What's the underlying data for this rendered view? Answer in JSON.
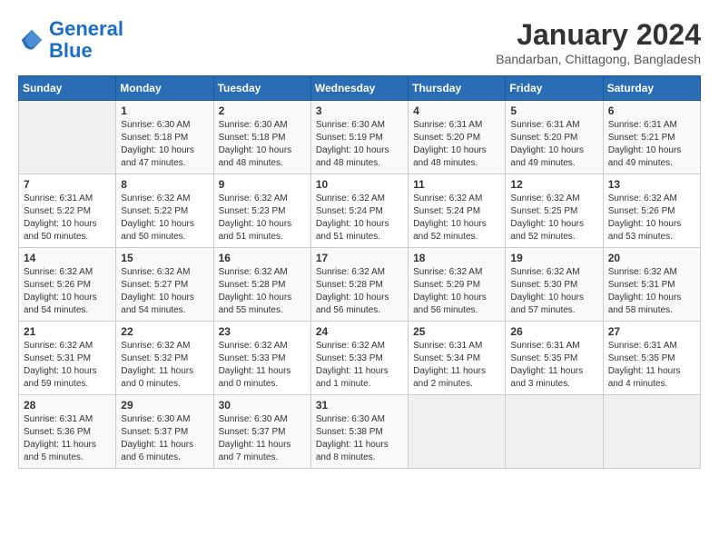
{
  "header": {
    "logo_line1": "General",
    "logo_line2": "Blue",
    "month_year": "January 2024",
    "location": "Bandarban, Chittagong, Bangladesh"
  },
  "weekdays": [
    "Sunday",
    "Monday",
    "Tuesday",
    "Wednesday",
    "Thursday",
    "Friday",
    "Saturday"
  ],
  "weeks": [
    [
      {
        "day": "",
        "sunrise": "",
        "sunset": "",
        "daylight": ""
      },
      {
        "day": "1",
        "sunrise": "Sunrise: 6:30 AM",
        "sunset": "Sunset: 5:18 PM",
        "daylight": "Daylight: 10 hours and 47 minutes."
      },
      {
        "day": "2",
        "sunrise": "Sunrise: 6:30 AM",
        "sunset": "Sunset: 5:18 PM",
        "daylight": "Daylight: 10 hours and 48 minutes."
      },
      {
        "day": "3",
        "sunrise": "Sunrise: 6:30 AM",
        "sunset": "Sunset: 5:19 PM",
        "daylight": "Daylight: 10 hours and 48 minutes."
      },
      {
        "day": "4",
        "sunrise": "Sunrise: 6:31 AM",
        "sunset": "Sunset: 5:20 PM",
        "daylight": "Daylight: 10 hours and 48 minutes."
      },
      {
        "day": "5",
        "sunrise": "Sunrise: 6:31 AM",
        "sunset": "Sunset: 5:20 PM",
        "daylight": "Daylight: 10 hours and 49 minutes."
      },
      {
        "day": "6",
        "sunrise": "Sunrise: 6:31 AM",
        "sunset": "Sunset: 5:21 PM",
        "daylight": "Daylight: 10 hours and 49 minutes."
      }
    ],
    [
      {
        "day": "7",
        "sunrise": "Sunrise: 6:31 AM",
        "sunset": "Sunset: 5:22 PM",
        "daylight": "Daylight: 10 hours and 50 minutes."
      },
      {
        "day": "8",
        "sunrise": "Sunrise: 6:32 AM",
        "sunset": "Sunset: 5:22 PM",
        "daylight": "Daylight: 10 hours and 50 minutes."
      },
      {
        "day": "9",
        "sunrise": "Sunrise: 6:32 AM",
        "sunset": "Sunset: 5:23 PM",
        "daylight": "Daylight: 10 hours and 51 minutes."
      },
      {
        "day": "10",
        "sunrise": "Sunrise: 6:32 AM",
        "sunset": "Sunset: 5:24 PM",
        "daylight": "Daylight: 10 hours and 51 minutes."
      },
      {
        "day": "11",
        "sunrise": "Sunrise: 6:32 AM",
        "sunset": "Sunset: 5:24 PM",
        "daylight": "Daylight: 10 hours and 52 minutes."
      },
      {
        "day": "12",
        "sunrise": "Sunrise: 6:32 AM",
        "sunset": "Sunset: 5:25 PM",
        "daylight": "Daylight: 10 hours and 52 minutes."
      },
      {
        "day": "13",
        "sunrise": "Sunrise: 6:32 AM",
        "sunset": "Sunset: 5:26 PM",
        "daylight": "Daylight: 10 hours and 53 minutes."
      }
    ],
    [
      {
        "day": "14",
        "sunrise": "Sunrise: 6:32 AM",
        "sunset": "Sunset: 5:26 PM",
        "daylight": "Daylight: 10 hours and 54 minutes."
      },
      {
        "day": "15",
        "sunrise": "Sunrise: 6:32 AM",
        "sunset": "Sunset: 5:27 PM",
        "daylight": "Daylight: 10 hours and 54 minutes."
      },
      {
        "day": "16",
        "sunrise": "Sunrise: 6:32 AM",
        "sunset": "Sunset: 5:28 PM",
        "daylight": "Daylight: 10 hours and 55 minutes."
      },
      {
        "day": "17",
        "sunrise": "Sunrise: 6:32 AM",
        "sunset": "Sunset: 5:28 PM",
        "daylight": "Daylight: 10 hours and 56 minutes."
      },
      {
        "day": "18",
        "sunrise": "Sunrise: 6:32 AM",
        "sunset": "Sunset: 5:29 PM",
        "daylight": "Daylight: 10 hours and 56 minutes."
      },
      {
        "day": "19",
        "sunrise": "Sunrise: 6:32 AM",
        "sunset": "Sunset: 5:30 PM",
        "daylight": "Daylight: 10 hours and 57 minutes."
      },
      {
        "day": "20",
        "sunrise": "Sunrise: 6:32 AM",
        "sunset": "Sunset: 5:31 PM",
        "daylight": "Daylight: 10 hours and 58 minutes."
      }
    ],
    [
      {
        "day": "21",
        "sunrise": "Sunrise: 6:32 AM",
        "sunset": "Sunset: 5:31 PM",
        "daylight": "Daylight: 10 hours and 59 minutes."
      },
      {
        "day": "22",
        "sunrise": "Sunrise: 6:32 AM",
        "sunset": "Sunset: 5:32 PM",
        "daylight": "Daylight: 11 hours and 0 minutes."
      },
      {
        "day": "23",
        "sunrise": "Sunrise: 6:32 AM",
        "sunset": "Sunset: 5:33 PM",
        "daylight": "Daylight: 11 hours and 0 minutes."
      },
      {
        "day": "24",
        "sunrise": "Sunrise: 6:32 AM",
        "sunset": "Sunset: 5:33 PM",
        "daylight": "Daylight: 11 hours and 1 minute."
      },
      {
        "day": "25",
        "sunrise": "Sunrise: 6:31 AM",
        "sunset": "Sunset: 5:34 PM",
        "daylight": "Daylight: 11 hours and 2 minutes."
      },
      {
        "day": "26",
        "sunrise": "Sunrise: 6:31 AM",
        "sunset": "Sunset: 5:35 PM",
        "daylight": "Daylight: 11 hours and 3 minutes."
      },
      {
        "day": "27",
        "sunrise": "Sunrise: 6:31 AM",
        "sunset": "Sunset: 5:35 PM",
        "daylight": "Daylight: 11 hours and 4 minutes."
      }
    ],
    [
      {
        "day": "28",
        "sunrise": "Sunrise: 6:31 AM",
        "sunset": "Sunset: 5:36 PM",
        "daylight": "Daylight: 11 hours and 5 minutes."
      },
      {
        "day": "29",
        "sunrise": "Sunrise: 6:30 AM",
        "sunset": "Sunset: 5:37 PM",
        "daylight": "Daylight: 11 hours and 6 minutes."
      },
      {
        "day": "30",
        "sunrise": "Sunrise: 6:30 AM",
        "sunset": "Sunset: 5:37 PM",
        "daylight": "Daylight: 11 hours and 7 minutes."
      },
      {
        "day": "31",
        "sunrise": "Sunrise: 6:30 AM",
        "sunset": "Sunset: 5:38 PM",
        "daylight": "Daylight: 11 hours and 8 minutes."
      },
      {
        "day": "",
        "sunrise": "",
        "sunset": "",
        "daylight": ""
      },
      {
        "day": "",
        "sunrise": "",
        "sunset": "",
        "daylight": ""
      },
      {
        "day": "",
        "sunrise": "",
        "sunset": "",
        "daylight": ""
      }
    ]
  ]
}
